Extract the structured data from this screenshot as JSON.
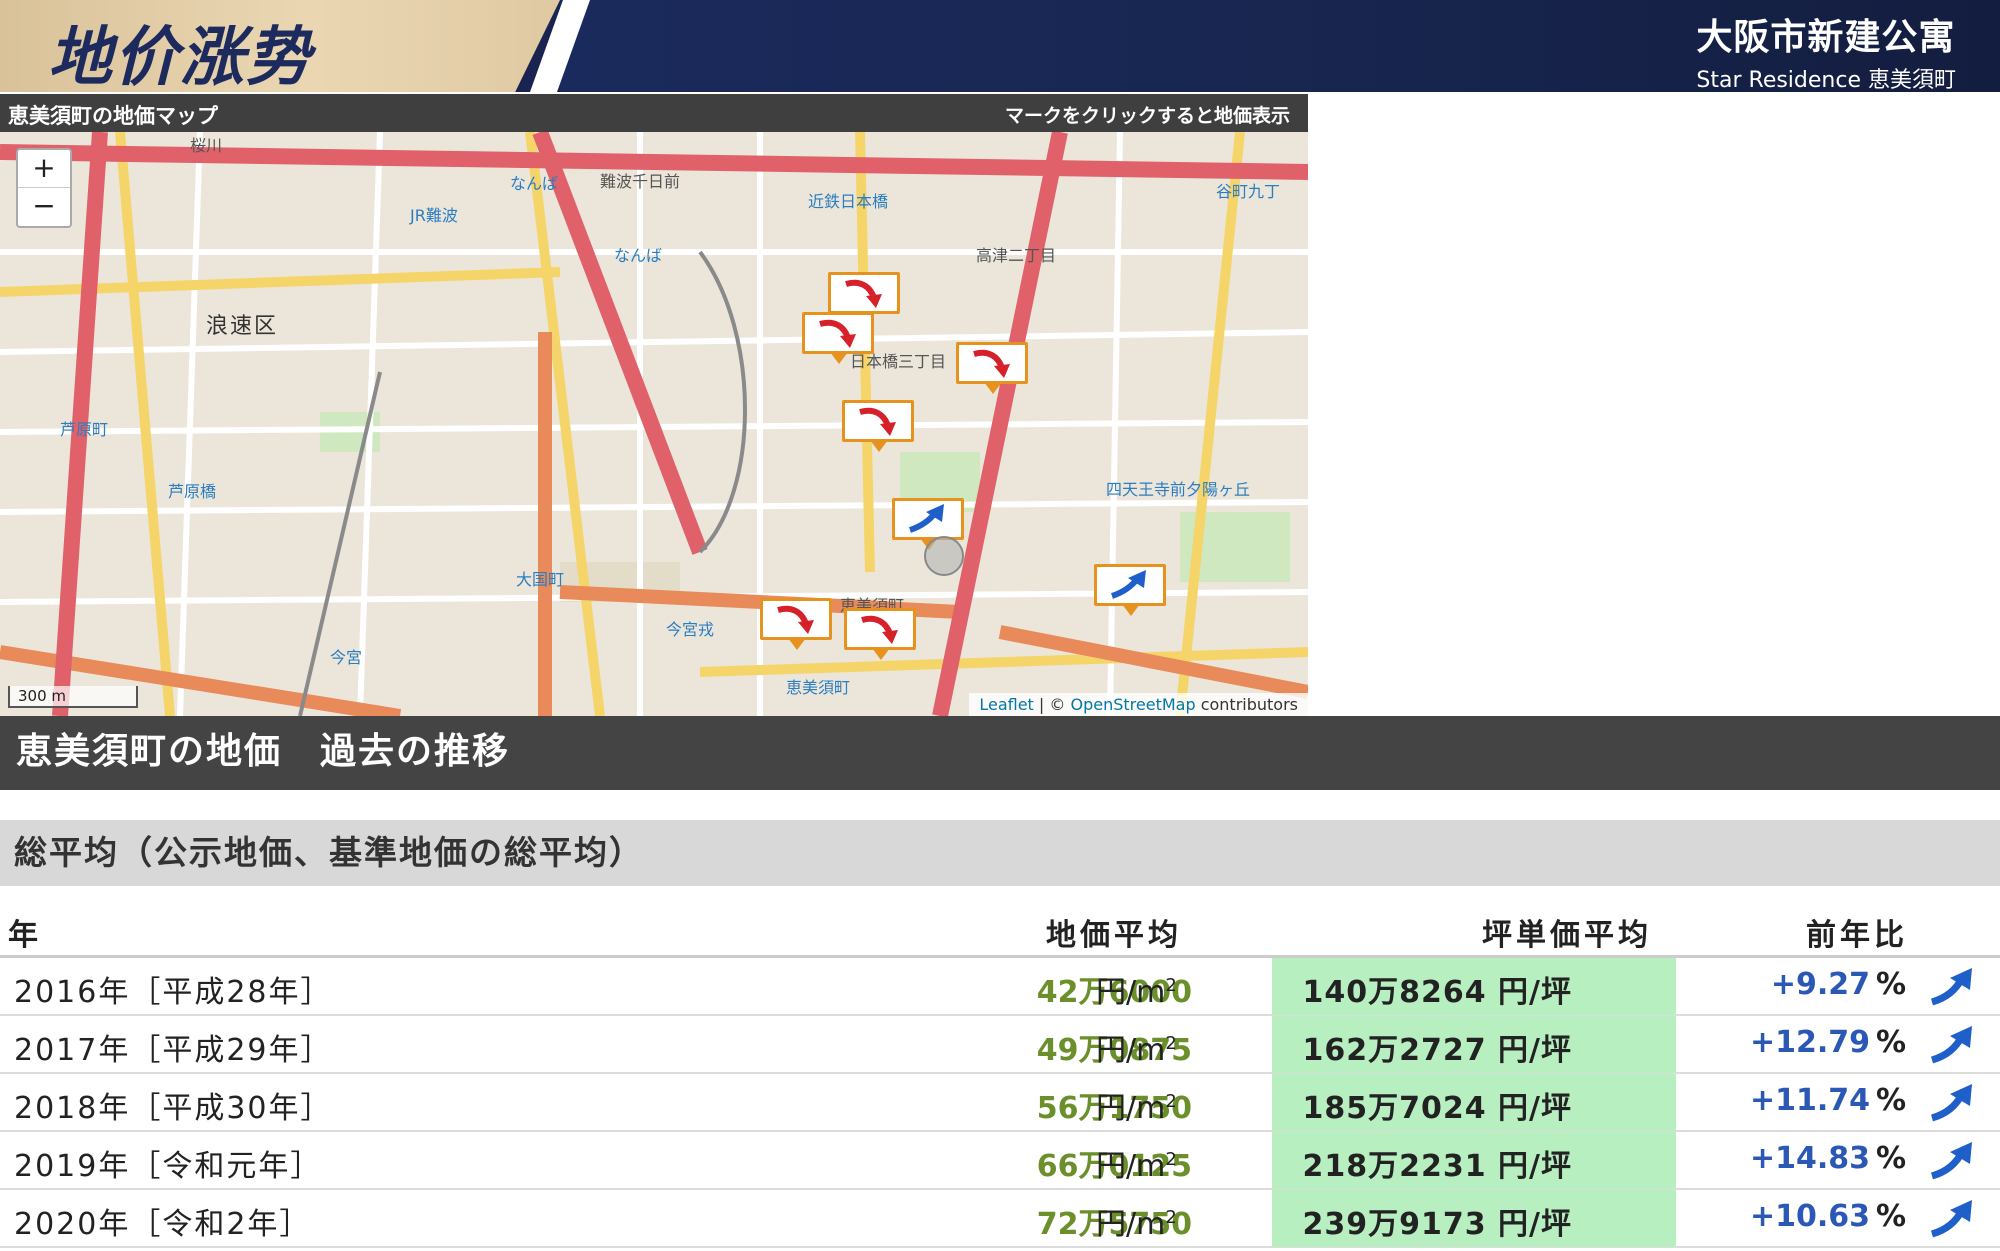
{
  "header": {
    "title": "地价涨势",
    "brand": "大阪市新建公寓",
    "subtitle": "Star Residence 恵美須町"
  },
  "map": {
    "title": "恵美須町の地価マップ",
    "hint": "マークをクリックすると地価表示",
    "zoom_in": "+",
    "zoom_out": "−",
    "scale": "300 m",
    "attribution": {
      "leaflet": "Leaflet",
      "sep": " | © ",
      "osm": "OpenStreetMap",
      "tail": " contributors"
    },
    "labels": {
      "sakuragawa": "桜川",
      "namba1": "なんば",
      "jr_namba": "JR難波",
      "namba2": "なんば",
      "kintetsu": "近鉄日本橋",
      "naniwa": "浪速区",
      "ashiharacho": "芦原町",
      "ashiharabashi": "芦原橋",
      "daikokucho": "大国町",
      "imamiya": "今宮",
      "imamiyaebisu": "今宮戎",
      "ebisucho": "恵美須町",
      "ebisucho_st": "恵美須町",
      "shitennoji": "四天王寺前夕陽ヶ丘",
      "tanimachi": "谷町九丁",
      "nippombashi": "日本橋三丁目",
      "takatsu": "高津二丁目",
      "nambasennichimae": "難波千日前"
    },
    "markers": [
      {
        "trend": "down"
      },
      {
        "trend": "down"
      },
      {
        "trend": "down"
      },
      {
        "trend": "down"
      },
      {
        "trend": "up"
      },
      {
        "trend": "up"
      },
      {
        "trend": "down"
      },
      {
        "trend": "down"
      }
    ],
    "colors": {
      "down": "#d6202a",
      "up": "#1f5fc9",
      "marker_border": "#e6921f"
    }
  },
  "section": {
    "title": "恵美須町の地価　過去の推移",
    "subtitle": "総平均（公示地価、基準地価の総平均）"
  },
  "table": {
    "headers": {
      "year": "年",
      "land_price": "地価平均",
      "tsubo_price": "坪単価平均",
      "yoy": "前年比"
    },
    "unit_m2": "円/m",
    "unit_m2_sup": "2",
    "unit_tsubo": "円/坪",
    "unit_pct": "%",
    "rows": [
      {
        "year": "2016年［平成28年］",
        "land_price": "42万6000",
        "tsubo_price": "140万8264",
        "yoy": "+9.27",
        "trend": "up"
      },
      {
        "year": "2017年［平成29年］",
        "land_price": "49万0875",
        "tsubo_price": "162万2727",
        "yoy": "+12.79",
        "trend": "up"
      },
      {
        "year": "2018年［平成30年］",
        "land_price": "56万1750",
        "tsubo_price": "185万7024",
        "yoy": "+11.74",
        "trend": "up"
      },
      {
        "year": "2019年［令和元年］",
        "land_price": "66万0125",
        "tsubo_price": "218万2231",
        "yoy": "+14.83",
        "trend": "up"
      },
      {
        "year": "2020年［令和2年］",
        "land_price": "72万5750",
        "tsubo_price": "239万9173",
        "yoy": "+10.63",
        "trend": "up"
      }
    ]
  }
}
